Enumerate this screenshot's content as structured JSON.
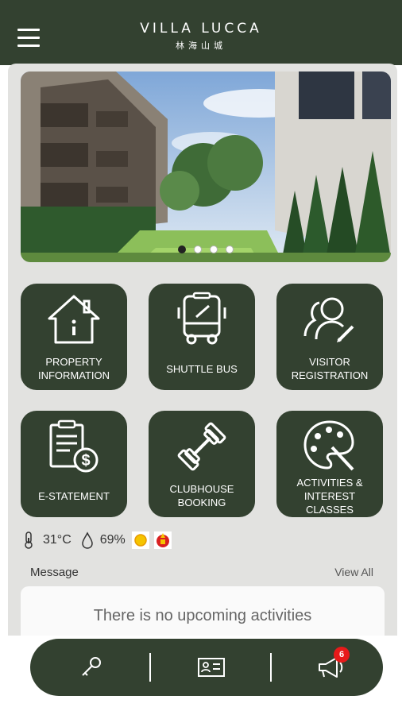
{
  "app": {
    "brand_name": "VILLA LUCCA",
    "brand_sub": "林海山城"
  },
  "banner": {
    "slides": 4,
    "active_index": 0
  },
  "tiles": [
    {
      "label_line1": "PROPERTY",
      "label_line2": "INFORMATION",
      "icon": "house-icon"
    },
    {
      "label_line1": "SHUTTLE BUS",
      "label_line2": "",
      "icon": "bus-icon"
    },
    {
      "label_line1": "VISITOR",
      "label_line2": "REGISTRATION",
      "icon": "visitor-icon"
    },
    {
      "label_line1": "E-STATEMENT",
      "label_line2": "",
      "icon": "statement-icon"
    },
    {
      "label_line1": "CLUBHOUSE",
      "label_line2": "BOOKING",
      "icon": "dumbbell-icon"
    },
    {
      "label_line1": "ACTIVITIES &",
      "label_line2": "INTEREST",
      "label_line3": "CLASSES",
      "icon": "palette-icon"
    }
  ],
  "weather": {
    "temperature": "31°C",
    "humidity": "69%"
  },
  "messages": {
    "title": "Message",
    "view_all": "View All",
    "empty_text": "There is no upcoming activities"
  },
  "bottom_nav": {
    "notification_count": "6"
  },
  "colors": {
    "primary": "#334130",
    "background": "#e2e2e0",
    "badge": "#e81a1a"
  }
}
